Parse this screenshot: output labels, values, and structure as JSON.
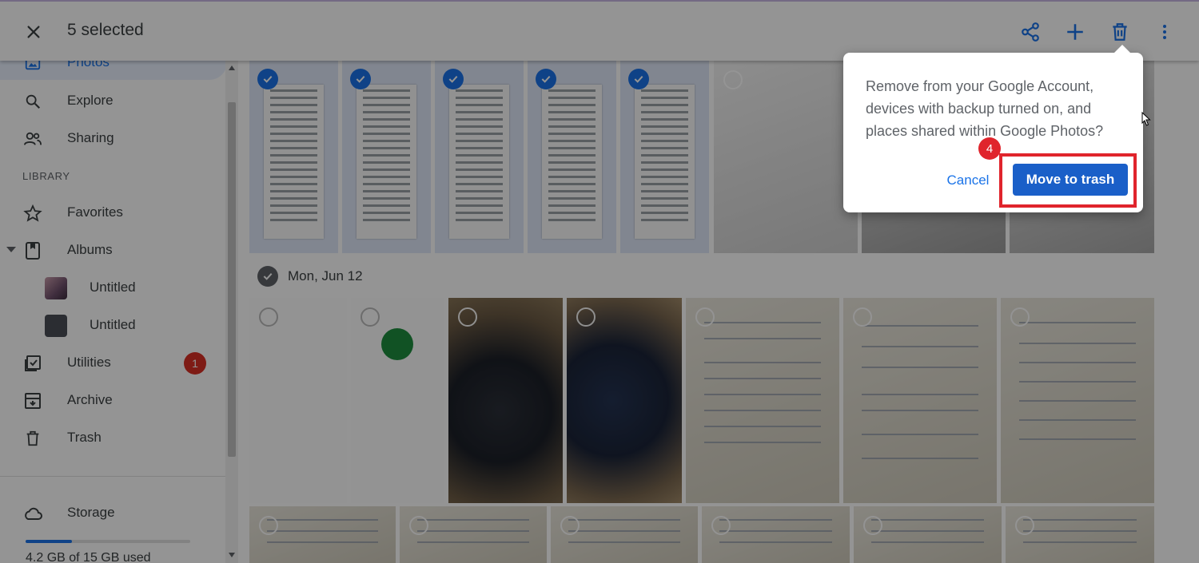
{
  "topbar": {
    "selection_title": "5 selected",
    "actions": [
      "share-icon",
      "add-icon",
      "trash-icon",
      "more-vert-icon"
    ]
  },
  "sidebar": {
    "items": [
      {
        "label": "Photos",
        "icon": "photos-icon",
        "active": true
      },
      {
        "label": "Explore",
        "icon": "search-icon"
      },
      {
        "label": "Sharing",
        "icon": "people-icon"
      }
    ],
    "library_heading": "LIBRARY",
    "library_items": [
      {
        "label": "Favorites",
        "icon": "star-icon"
      },
      {
        "label": "Albums",
        "icon": "album-icon"
      },
      {
        "label": "Untitled",
        "icon": "album-thumb"
      },
      {
        "label": "Untitled",
        "icon": "album-thumb"
      },
      {
        "label": "Utilities",
        "icon": "utilities-icon",
        "badge": "1"
      },
      {
        "label": "Archive",
        "icon": "archive-icon"
      },
      {
        "label": "Trash",
        "icon": "trash-icon"
      }
    ],
    "storage": {
      "label": "Storage",
      "usage_text": "4.2 GB of 15 GB used",
      "used_fraction": 0.28
    }
  },
  "main": {
    "date_heading": "Mon, Jun 12"
  },
  "dialog": {
    "message": "Remove from your Google Account, devices with backup turned on, and places shared within Google Photos?",
    "cancel_label": "Cancel",
    "confirm_label": "Move to trash"
  },
  "annotation": {
    "step_number": "4"
  },
  "colors": {
    "accent": "#1a73e8",
    "highlight": "#e0242c",
    "badge": "#d93025"
  }
}
